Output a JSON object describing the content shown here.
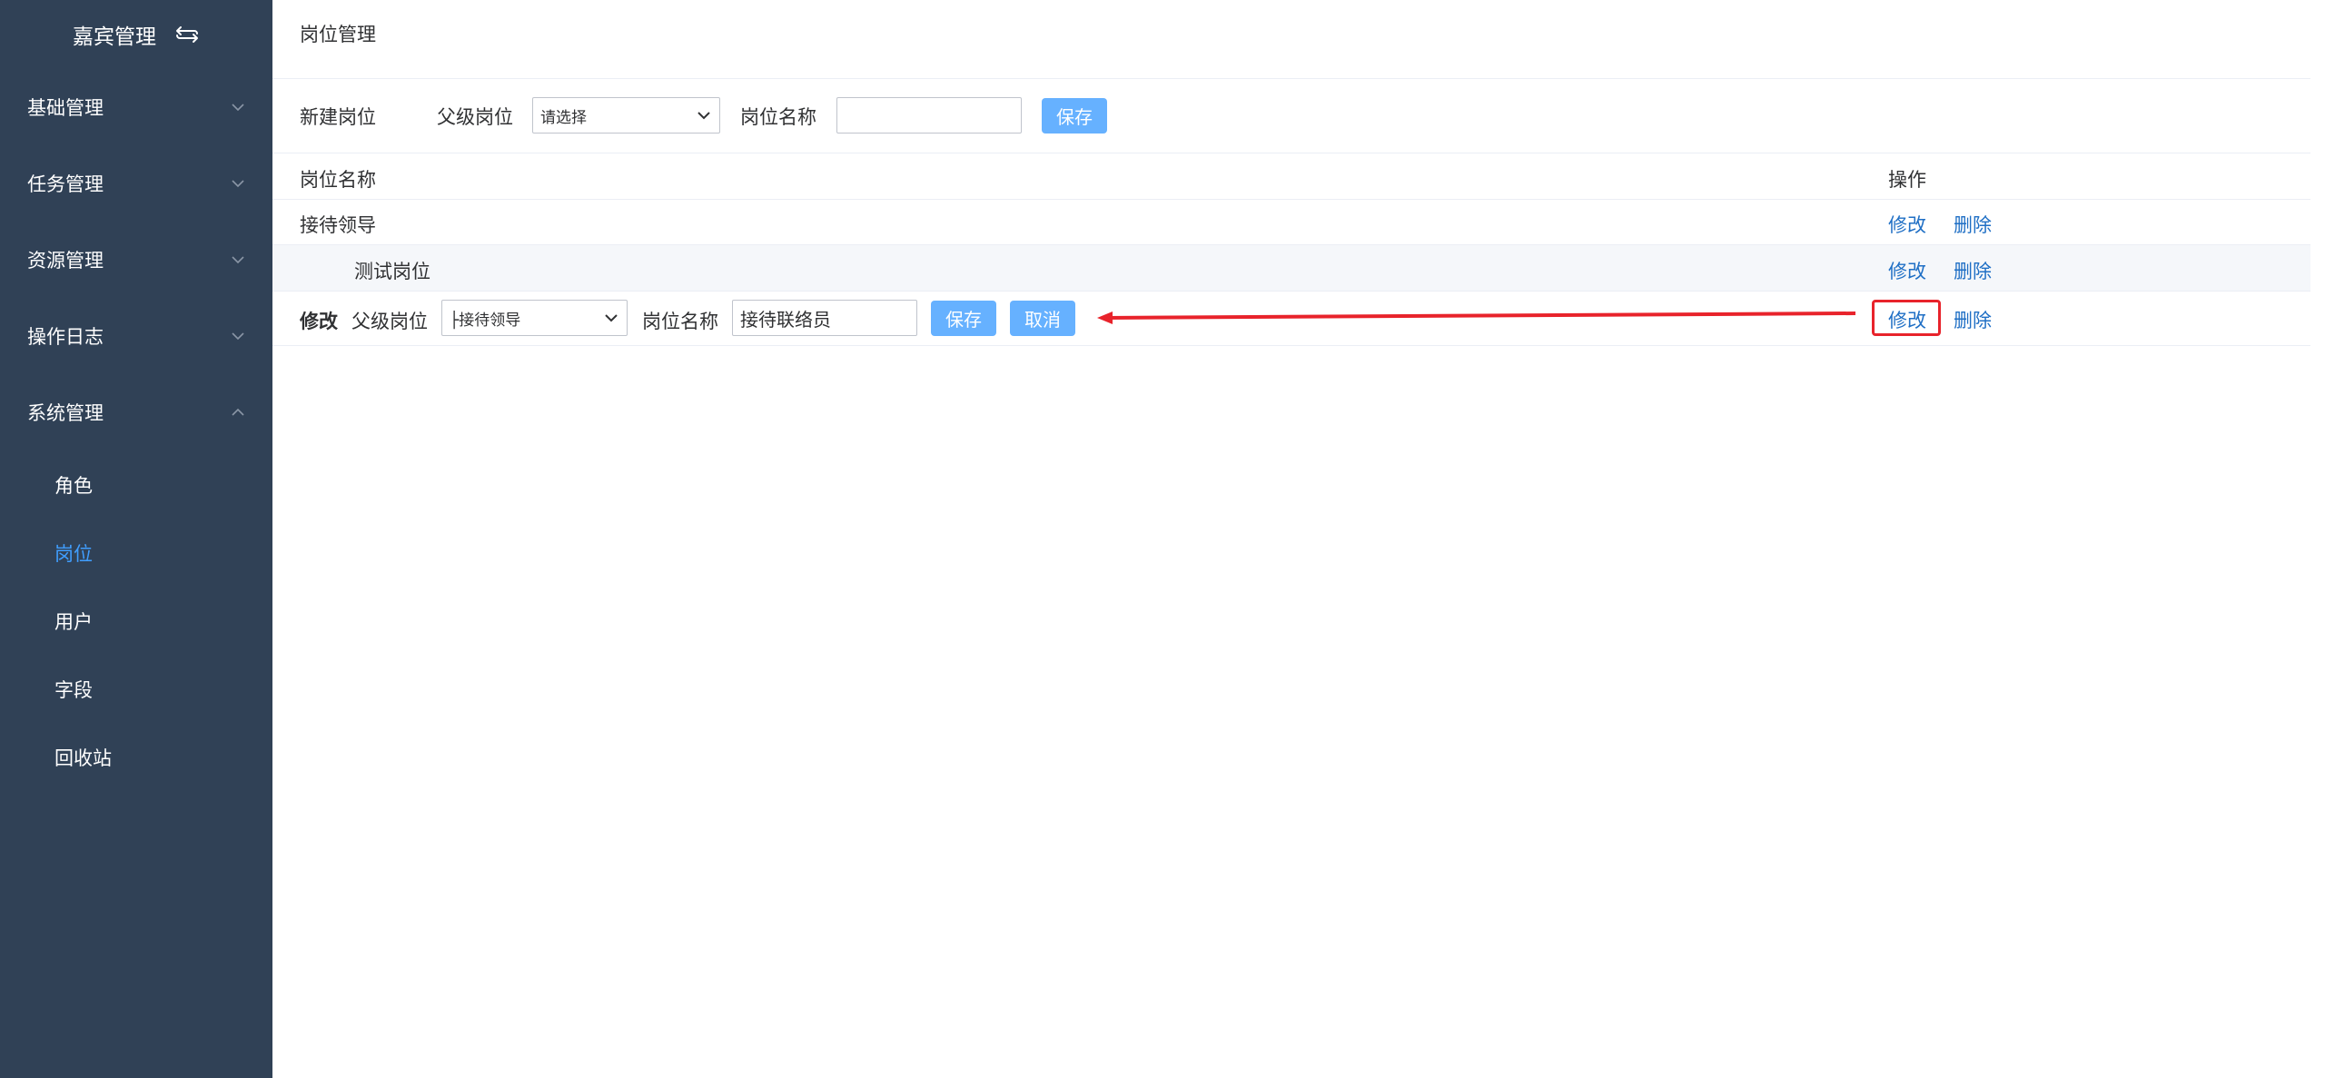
{
  "sidebar": {
    "brand": "嘉宾管理",
    "brand_icon": "swap-arrows-icon",
    "menus": [
      {
        "label": "基础管理",
        "expanded": false
      },
      {
        "label": "任务管理",
        "expanded": false
      },
      {
        "label": "资源管理",
        "expanded": false
      },
      {
        "label": "操作日志",
        "expanded": false
      },
      {
        "label": "系统管理",
        "expanded": true
      }
    ],
    "sub_items": [
      {
        "label": "角色",
        "active": false
      },
      {
        "label": "岗位",
        "active": true
      },
      {
        "label": "用户",
        "active": false
      },
      {
        "label": "字段",
        "active": false
      },
      {
        "label": "回收站",
        "active": false
      }
    ]
  },
  "main": {
    "title": "岗位管理",
    "new_form": {
      "label": "新建岗位",
      "parent_label": "父级岗位",
      "parent_value": "请选择",
      "name_label": "岗位名称",
      "name_value": "",
      "save_label": "保存"
    },
    "table": {
      "headers": [
        "岗位名称",
        "操作"
      ],
      "rows": [
        {
          "name": "接待领导",
          "indent": false,
          "edit": "修改",
          "delete": "删除"
        },
        {
          "name": "测试岗位",
          "indent": true,
          "edit": "修改",
          "delete": "删除"
        }
      ],
      "edit_row": {
        "label": "修改",
        "parent_label": "父级岗位",
        "parent_value": "├接待领导",
        "name_label": "岗位名称",
        "name_value": "接待联络员",
        "save_label": "保存",
        "cancel_label": "取消",
        "edit": "修改",
        "delete": "删除"
      }
    }
  },
  "colors": {
    "sidebar_bg": "#304156",
    "active": "#409eff",
    "button": "#66b1ff",
    "link": "#1f6fc5",
    "annotation": "#e8232b"
  }
}
